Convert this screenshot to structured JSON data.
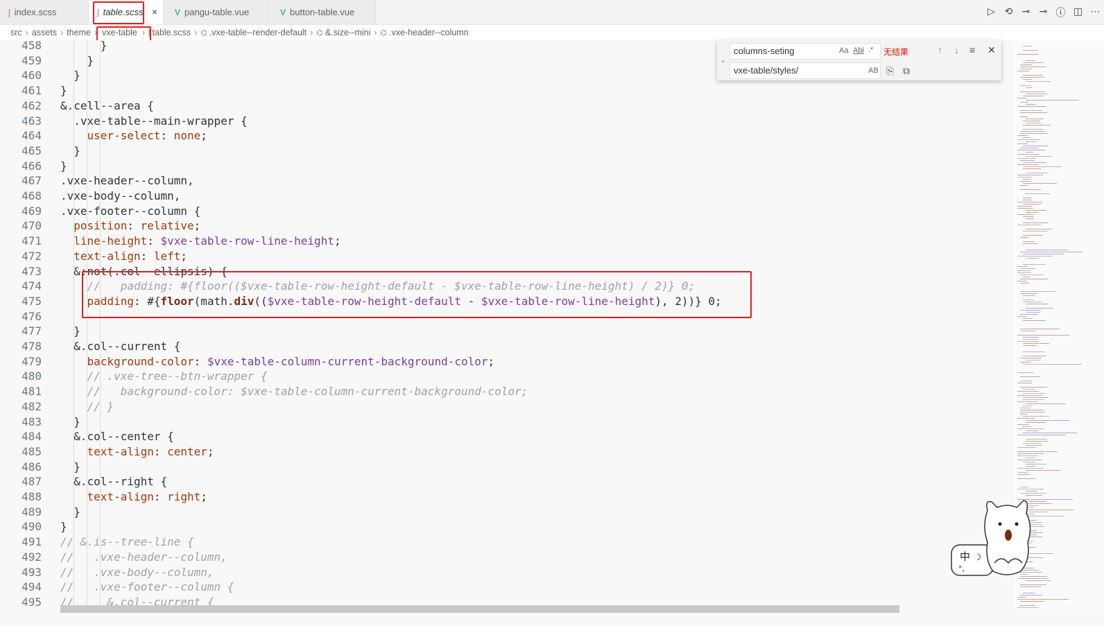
{
  "tabs": [
    {
      "label": "index.scss",
      "type": "scss"
    },
    {
      "label": "table.scss",
      "type": "scss",
      "active": true,
      "close": "×"
    },
    {
      "label": "pangu-table.vue",
      "type": "vue"
    },
    {
      "label": "button-table.vue",
      "type": "vue"
    }
  ],
  "title_actions": [
    "run-icon",
    "source-control-icon",
    "step-icon",
    "step-over-icon",
    "info-icon",
    "split-editor-icon",
    "more-icon"
  ],
  "breadcrumb": [
    "src",
    "assets",
    "theme",
    "vxe-table",
    "table.scss",
    ".vxe-table--render-default",
    "&.size--mini",
    ".vxe-header--column"
  ],
  "find": {
    "find_value": "columns-seting",
    "replace_value": "vxe-table/styles/",
    "match_case": "Aa",
    "whole_word": "Abl",
    "regex": ".*",
    "preserve_case": "AB",
    "no_results": "无结果"
  },
  "code_lines": [
    {
      "n": "458",
      "segs": [
        {
          "t": "      }",
          "c": "t-sel"
        }
      ]
    },
    {
      "n": "459",
      "segs": [
        {
          "t": "    }",
          "c": "t-sel"
        }
      ]
    },
    {
      "n": "460",
      "segs": [
        {
          "t": "  }",
          "c": "t-sel"
        }
      ]
    },
    {
      "n": "461",
      "segs": [
        {
          "t": "}",
          "c": "t-sel"
        }
      ]
    },
    {
      "n": "462",
      "segs": [
        {
          "t": "&.cell--area {",
          "c": "t-sel"
        }
      ]
    },
    {
      "n": "463",
      "segs": [
        {
          "t": "  .vxe-table--main-wrapper {",
          "c": "t-sel"
        }
      ]
    },
    {
      "n": "464",
      "segs": [
        {
          "t": "    user-select",
          "c": "t-prop"
        },
        {
          "t": ": ",
          "c": "t-sel"
        },
        {
          "t": "none",
          "c": "t-val"
        },
        {
          "t": ";",
          "c": "t-sel"
        }
      ]
    },
    {
      "n": "465",
      "segs": [
        {
          "t": "  }",
          "c": "t-sel"
        }
      ]
    },
    {
      "n": "466",
      "segs": [
        {
          "t": "}",
          "c": "t-sel"
        }
      ]
    },
    {
      "n": "467",
      "segs": [
        {
          "t": ".vxe-header--column,",
          "c": "t-sel"
        }
      ]
    },
    {
      "n": "468",
      "segs": [
        {
          "t": ".vxe-body--column,",
          "c": "t-sel"
        }
      ]
    },
    {
      "n": "469",
      "segs": [
        {
          "t": ".vxe-footer--column {",
          "c": "t-sel"
        }
      ]
    },
    {
      "n": "470",
      "segs": [
        {
          "t": "  position",
          "c": "t-prop"
        },
        {
          "t": ": ",
          "c": "t-sel"
        },
        {
          "t": "relative",
          "c": "t-val"
        },
        {
          "t": ";",
          "c": "t-sel"
        }
      ]
    },
    {
      "n": "471",
      "segs": [
        {
          "t": "  line-height",
          "c": "t-prop"
        },
        {
          "t": ": ",
          "c": "t-sel"
        },
        {
          "t": "$vxe-table-row-line-height",
          "c": "t-var"
        },
        {
          "t": ";",
          "c": "t-sel"
        }
      ]
    },
    {
      "n": "472",
      "segs": [
        {
          "t": "  text-align",
          "c": "t-prop"
        },
        {
          "t": ": ",
          "c": "t-sel"
        },
        {
          "t": "left",
          "c": "t-val"
        },
        {
          "t": ";",
          "c": "t-sel"
        }
      ]
    },
    {
      "n": "473",
      "segs": [
        {
          "t": "  &:not(.col--ellipsis) {",
          "c": "t-sel"
        }
      ]
    },
    {
      "n": "474",
      "segs": [
        {
          "t": "    //   padding: #{floor(($vxe-table-row-height-default - $vxe-table-row-line-height) / 2)} 0;",
          "c": "t-cmt"
        }
      ]
    },
    {
      "n": "475",
      "segs": [
        {
          "t": "    padding",
          "c": "t-prop"
        },
        {
          "t": ": #{",
          "c": "t-sel"
        },
        {
          "t": "floor",
          "c": "t-fn"
        },
        {
          "t": "(math.",
          "c": "t-sel"
        },
        {
          "t": "div",
          "c": "t-fn"
        },
        {
          "t": "((",
          "c": "t-sel"
        },
        {
          "t": "$vxe-table-row-height-default",
          "c": "t-var"
        },
        {
          "t": " - ",
          "c": "t-sel"
        },
        {
          "t": "$vxe-table-row-line-height",
          "c": "t-var"
        },
        {
          "t": "), 2))} 0;",
          "c": "t-sel"
        }
      ]
    },
    {
      "n": "476",
      "segs": [
        {
          "t": "",
          "c": "t-sel"
        }
      ]
    },
    {
      "n": "477",
      "segs": [
        {
          "t": "  }",
          "c": "t-sel"
        }
      ]
    },
    {
      "n": "478",
      "segs": [
        {
          "t": "  &.col--current {",
          "c": "t-sel"
        }
      ]
    },
    {
      "n": "479",
      "segs": [
        {
          "t": "    background-color",
          "c": "t-prop"
        },
        {
          "t": ": ",
          "c": "t-sel"
        },
        {
          "t": "$vxe-table-column-current-background-color",
          "c": "t-var"
        },
        {
          "t": ";",
          "c": "t-sel"
        }
      ]
    },
    {
      "n": "480",
      "segs": [
        {
          "t": "    // .vxe-tree--btn-wrapper {",
          "c": "t-cmt"
        }
      ]
    },
    {
      "n": "481",
      "segs": [
        {
          "t": "    //   background-color: $vxe-table-column-current-background-color;",
          "c": "t-cmt"
        }
      ]
    },
    {
      "n": "482",
      "segs": [
        {
          "t": "    // }",
          "c": "t-cmt"
        }
      ]
    },
    {
      "n": "483",
      "segs": [
        {
          "t": "  }",
          "c": "t-sel"
        }
      ]
    },
    {
      "n": "484",
      "segs": [
        {
          "t": "  &.col--center {",
          "c": "t-sel"
        }
      ]
    },
    {
      "n": "485",
      "segs": [
        {
          "t": "    text-align",
          "c": "t-prop"
        },
        {
          "t": ": ",
          "c": "t-sel"
        },
        {
          "t": "center",
          "c": "t-val"
        },
        {
          "t": ";",
          "c": "t-sel"
        }
      ]
    },
    {
      "n": "486",
      "segs": [
        {
          "t": "  }",
          "c": "t-sel"
        }
      ]
    },
    {
      "n": "487",
      "segs": [
        {
          "t": "  &.col--right {",
          "c": "t-sel"
        }
      ]
    },
    {
      "n": "488",
      "segs": [
        {
          "t": "    text-align",
          "c": "t-prop"
        },
        {
          "t": ": ",
          "c": "t-sel"
        },
        {
          "t": "right",
          "c": "t-val"
        },
        {
          "t": ";",
          "c": "t-sel"
        }
      ]
    },
    {
      "n": "489",
      "segs": [
        {
          "t": "  }",
          "c": "t-sel"
        }
      ]
    },
    {
      "n": "490",
      "segs": [
        {
          "t": "}",
          "c": "t-sel"
        }
      ]
    },
    {
      "n": "491",
      "segs": [
        {
          "t": "// &.is--tree-line {",
          "c": "t-cmt"
        }
      ]
    },
    {
      "n": "492",
      "segs": [
        {
          "t": "//   .vxe-header--column,",
          "c": "t-cmt"
        }
      ]
    },
    {
      "n": "493",
      "segs": [
        {
          "t": "//   .vxe-body--column,",
          "c": "t-cmt"
        }
      ]
    },
    {
      "n": "494",
      "segs": [
        {
          "t": "//   .vxe-footer--column {",
          "c": "t-cmt"
        }
      ]
    },
    {
      "n": "495",
      "segs": [
        {
          "t": "//     &.col--current {",
          "c": "t-cmt"
        }
      ]
    }
  ],
  "ime": {
    "label": "中",
    "moon": "☽"
  },
  "colors": {
    "highlight": "#e81c1c",
    "sass": "#cd6799",
    "vue": "#41b883"
  }
}
